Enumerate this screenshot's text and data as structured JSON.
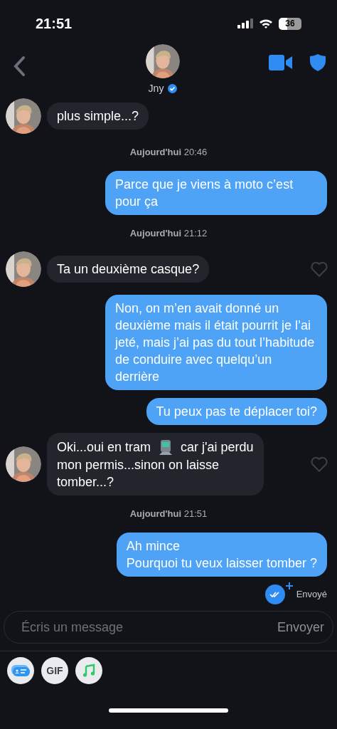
{
  "status_bar": {
    "time": "21:51",
    "battery": "36"
  },
  "header": {
    "name": "Jny",
    "verified": true
  },
  "messages": [
    {
      "kind": "in",
      "text": "plus simple...?",
      "heart": false
    },
    {
      "kind": "date",
      "day": "Aujourd'hui",
      "time": "20:46"
    },
    {
      "kind": "out",
      "text": "Parce que je viens à moto c’est pour ça"
    },
    {
      "kind": "date",
      "day": "Aujourd'hui",
      "time": "21:12"
    },
    {
      "kind": "in",
      "text": "Ta un deuxième casque?",
      "heart": true
    },
    {
      "kind": "out",
      "text": "Non, on m’en avait donné un deuxième mais il était pourrit je l’ai jeté, mais j’ai pas du tout l’habitude de conduire avec quelqu’un derrière"
    },
    {
      "kind": "out",
      "text": "Tu peux pas te déplacer toi?"
    },
    {
      "kind": "in",
      "lines": [
        [
          {
            "kind": "text",
            "text": "Oki...oui en tram"
          },
          {
            "kind": "tram"
          },
          {
            "kind": "text",
            "text": "car j'ai perdu"
          }
        ],
        [
          {
            "kind": "text",
            "text": "mon permis...sinon on laisse tomber...?"
          }
        ]
      ],
      "heart": true
    },
    {
      "kind": "date",
      "day": "Aujourd'hui",
      "time": "21:51"
    },
    {
      "kind": "out",
      "text": "Ah mince\nPourquoi tu veux laisser tomber ?"
    },
    {
      "kind": "status",
      "label": "Envoyé"
    }
  ],
  "composer": {
    "placeholder": "Écris un message",
    "send": "Envoyer"
  },
  "attachments": [
    {
      "kind": "card"
    },
    {
      "kind": "gif",
      "label": "GIF"
    },
    {
      "kind": "music"
    }
  ]
}
